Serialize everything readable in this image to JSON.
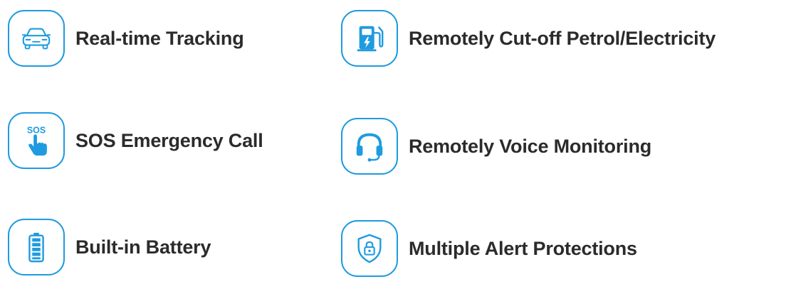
{
  "accent_color": "#1e9be0",
  "features": [
    {
      "label": "Real-time Tracking",
      "icon": "car-icon"
    },
    {
      "label": "Remotely Cut-off Petrol/Electricity",
      "icon": "fuel-pump-icon"
    },
    {
      "label": "SOS Emergency Call",
      "icon": "sos-hand-icon"
    },
    {
      "label": "Remotely Voice Monitoring",
      "icon": "headset-icon"
    },
    {
      "label": "Built-in Battery",
      "icon": "battery-icon"
    },
    {
      "label": "Multiple Alert Protections",
      "icon": "shield-lock-icon"
    }
  ],
  "sos_icon_text": "SOS"
}
